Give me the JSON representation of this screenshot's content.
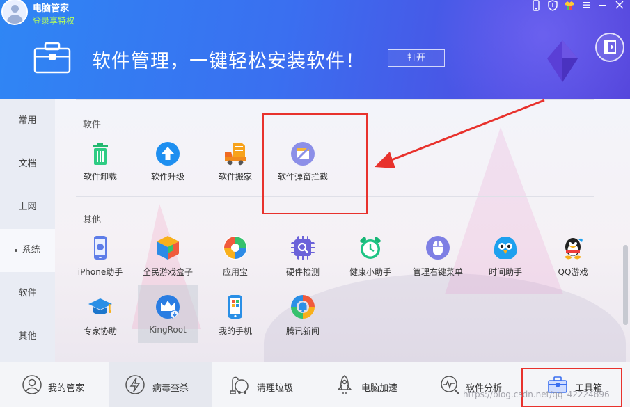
{
  "app": {
    "name": "电脑管家",
    "login_text": "登录享特权"
  },
  "banner": {
    "title": "软件管理，一键轻松安装软件！",
    "open_button": "打开"
  },
  "left_nav": [
    {
      "label": "常用"
    },
    {
      "label": "文档"
    },
    {
      "label": "上网"
    },
    {
      "label": "系统",
      "active": true
    },
    {
      "label": "软件"
    },
    {
      "label": "其他"
    }
  ],
  "sections": {
    "software": {
      "title": "软件",
      "items": [
        {
          "label": "软件卸载",
          "icon": "trash-icon"
        },
        {
          "label": "软件升级",
          "icon": "upgrade-icon"
        },
        {
          "label": "软件搬家",
          "icon": "truck-icon"
        },
        {
          "label": "软件弹窗拦截",
          "icon": "popup-block-icon"
        }
      ]
    },
    "other": {
      "title": "其他",
      "items": [
        {
          "label": "iPhone助手",
          "icon": "iphone-icon"
        },
        {
          "label": "全民游戏盒子",
          "icon": "game-box-icon"
        },
        {
          "label": "应用宝",
          "icon": "app-store-icon"
        },
        {
          "label": "硬件检测",
          "icon": "hardware-check-icon"
        },
        {
          "label": "健康小助手",
          "icon": "alarm-clock-icon"
        },
        {
          "label": "管理右键菜单",
          "icon": "mouse-icon"
        },
        {
          "label": "时间助手",
          "icon": "bird-icon"
        },
        {
          "label": "QQ游戏",
          "icon": "qq-penguin-icon"
        },
        {
          "label": "专家协助",
          "icon": "graduation-cap-icon"
        },
        {
          "label": "KingRoot",
          "icon": "crown-icon"
        },
        {
          "label": "我的手机",
          "icon": "phone-icon"
        },
        {
          "label": "腾讯新闻",
          "icon": "news-bell-icon"
        }
      ]
    }
  },
  "bottom_tabs": [
    {
      "label": "我的管家",
      "icon": "shield-avatar-icon"
    },
    {
      "label": "病毒查杀",
      "icon": "lightning-icon",
      "active": true
    },
    {
      "label": "清理垃圾",
      "icon": "vacuum-icon"
    },
    {
      "label": "电脑加速",
      "icon": "rocket-icon"
    },
    {
      "label": "软件分析",
      "icon": "analysis-icon"
    },
    {
      "label": "工具箱",
      "icon": "toolbox-icon"
    }
  ],
  "watermark": "https://blog.csdn.net/qq_42224896",
  "colors": {
    "header_start": "#2f86f4",
    "header_end": "#5546dc",
    "annotation_red": "#e8322d",
    "login_green": "#b6ff5a"
  }
}
